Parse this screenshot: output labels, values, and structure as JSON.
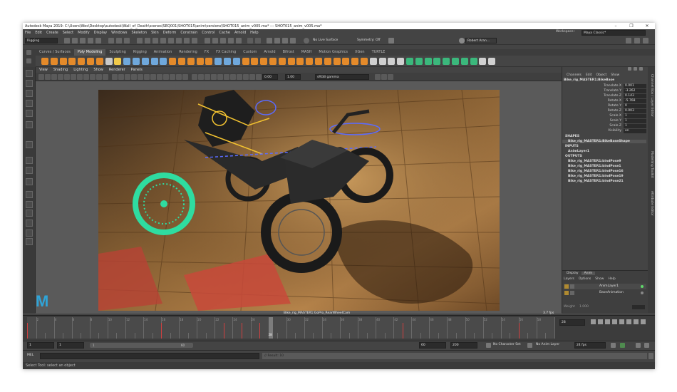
{
  "window": {
    "title": "Autodesk Maya 2019: C:\\Users\\Wes\\Desktop\\autodesk\\Wall_of_Death\\scenes\\SEQ001\\SHOT015\\anim\\versions\\SHOT015_anim_v005.ma*  ---  SHOT015_anim_v005.ma*",
    "minimize": "–",
    "maximize": "❐",
    "close": "✕"
  },
  "menubar": [
    "File",
    "Edit",
    "Create",
    "Select",
    "Modify",
    "Display",
    "Windows",
    "Skeleton",
    "Skin",
    "Deform",
    "Constrain",
    "Control",
    "Cache",
    "Arnold",
    "Help"
  ],
  "workspace": {
    "label": "Workspace :",
    "value": "Maya Classic*"
  },
  "status": {
    "menuset": "Rigging",
    "live_surface": "No Live Surface",
    "symmetry": "Symmetry: Off",
    "user": "Robert Aran..."
  },
  "shelf_tabs": [
    "Curves / Surfaces",
    "Poly Modeling",
    "Sculpting",
    "Rigging",
    "Animation",
    "Rendering",
    "FX",
    "FX Caching",
    "Custom",
    "Arnold",
    "Bifrost",
    "MASH",
    "Motion Graphics",
    "XGen",
    "TURTLE"
  ],
  "shelf_active": "Poly Modeling",
  "viewport": {
    "menus": [
      "View",
      "Shading",
      "Lighting",
      "Show",
      "Renderer",
      "Panels"
    ],
    "field1": "0.00",
    "field2": "1.00",
    "colorspace": "sRGB gamma",
    "camera_label": "Bike_rig_MASTER1:GoPro_RearWheelCam",
    "fps": "3.7 fps",
    "logo": "M"
  },
  "channel_box": {
    "tabs": [
      "Channels",
      "Edit",
      "Object",
      "Show"
    ],
    "object": "Bike_rig_MASTER1:BikeBase",
    "channels": [
      {
        "label": "Translate X",
        "value": "0.001"
      },
      {
        "label": "Translate Y",
        "value": "-3.262"
      },
      {
        "label": "Translate Z",
        "value": "0.143"
      },
      {
        "label": "Rotate X",
        "value": "-5.768"
      },
      {
        "label": "Rotate Y",
        "value": "0"
      },
      {
        "label": "Rotate Z",
        "value": "0.003"
      },
      {
        "label": "Scale X",
        "value": "1"
      },
      {
        "label": "Scale Y",
        "value": "1"
      },
      {
        "label": "Scale Z",
        "value": "1"
      },
      {
        "label": "Visibility",
        "value": "on"
      }
    ],
    "shapes_header": "SHAPES",
    "shapes": [
      "Bike_rig_MASTER1:BikeBaseShape"
    ],
    "inputs_header": "INPUTS",
    "inputs": [
      "AnimLayer1"
    ],
    "outputs_header": "OUTPUTS",
    "outputs": [
      "Bike_rig_MASTER1:bindPose9",
      "Bike_rig_MASTER1:bindPose1",
      "Bike_rig_MASTER1:bindPose16",
      "Bike_rig_MASTER1:bindPose19",
      "Bike_rig_MASTER1:bindPose21"
    ]
  },
  "layer_editor": {
    "tabs": [
      "Display",
      "Anim"
    ],
    "active_tab": "Anim",
    "menus": [
      "Layers",
      "Options",
      "Show",
      "Help"
    ],
    "layers": [
      "AnimLayer1",
      "BaseAnimation"
    ],
    "weight_label": "Weight",
    "weight_value": "1.000"
  },
  "side_tabs": [
    "Channel Box / Layer Editor",
    "Modelling Toolkit",
    "Attribute Editor"
  ],
  "timeline": {
    "ticks": [
      "2",
      "4",
      "6",
      "8",
      "10",
      "12",
      "14",
      "16",
      "18",
      "20",
      "22",
      "24",
      "26",
      "28",
      "30",
      "32",
      "34",
      "36",
      "38",
      "40",
      "42",
      "44",
      "46",
      "48",
      "50",
      "52",
      "54",
      "56",
      "58"
    ],
    "current_frame": "28",
    "current_field": "28"
  },
  "range": {
    "start": "1",
    "start2": "1",
    "range_label": "1",
    "range_end_label": "60",
    "end": "60",
    "end2": "200",
    "character_set": "No Character Set",
    "anim_layer": "No Anim Layer",
    "fps": "24 fps"
  },
  "command": {
    "label": "MEL",
    "result": "// Result: 10"
  },
  "help_line": "Select Tool: select an object"
}
